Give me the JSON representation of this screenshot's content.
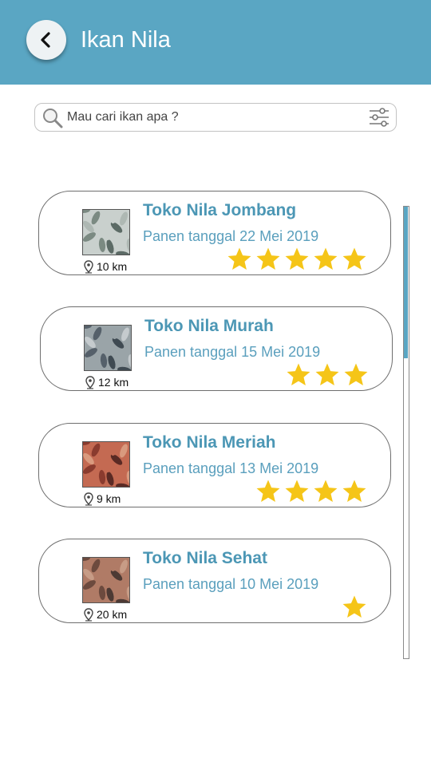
{
  "header": {
    "title": "Ikan Nila",
    "back_icon": "chevron-left-icon",
    "color": "#5aa6c3"
  },
  "search": {
    "placeholder": "Mau cari ikan apa ?",
    "value": "",
    "search_icon": "search-icon",
    "filter_icon": "sliders-icon"
  },
  "stores": [
    {
      "name": "Toko Nila Jombang",
      "harvest": "Panen tanggal 22 Mei 2019",
      "distance": "10 km",
      "rating": 5,
      "image": "fish-photo"
    },
    {
      "name": "Toko Nila Murah",
      "harvest": "Panen tanggal 15 Mei 2019",
      "distance": "12 km",
      "rating": 3,
      "image": "fish-photo"
    },
    {
      "name": "Toko Nila Meriah",
      "harvest": "Panen tanggal 13 Mei 2019",
      "distance": "9 km",
      "rating": 4,
      "image": "fish-photo"
    },
    {
      "name": "Toko Nila Sehat",
      "harvest": "Panen tanggal 10 Mei 2019",
      "distance": "20 km",
      "rating": 1,
      "image": "fish-photo"
    }
  ],
  "colors": {
    "accent": "#5aa6c3",
    "star": "#f5c518",
    "title_text": "#4c97b5"
  }
}
